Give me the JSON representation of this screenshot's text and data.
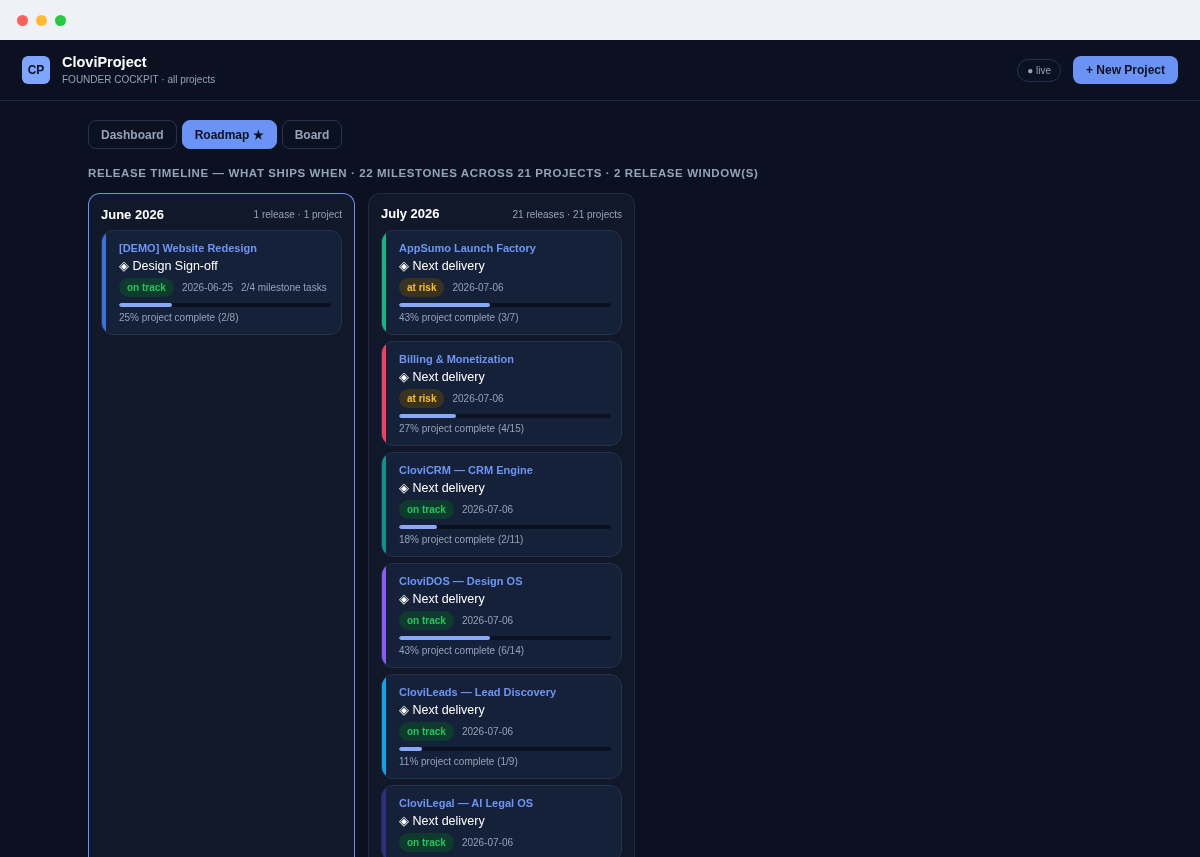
{
  "app": {
    "logo": "CP",
    "title": "CloviProject",
    "subtitle": "FOUNDER COCKPIT · all projects",
    "live_badge": "● live",
    "new_button": "+ New Project"
  },
  "tabs": [
    {
      "label": "Dashboard",
      "selected": false
    },
    {
      "label": "Roadmap ★",
      "selected": true
    },
    {
      "label": "Board",
      "selected": false
    }
  ],
  "heading": "RELEASE TIMELINE — WHAT SHIPS WHEN · 22 MILESTONES ACROSS 21 PROJECTS · 2 RELEASE WINDOW(S)",
  "columns": [
    {
      "title": "June 2026",
      "summary": "1 release · 1 project",
      "selected": true,
      "cards": [
        {
          "project": "[DEMO] Website Redesign",
          "milestone": "◈ Design Sign-off",
          "status": "on track",
          "kind": "on_track",
          "date": "2026-06-25",
          "tasks": "2/4 milestone tasks",
          "level": 0.25,
          "progress": "25% project complete (2/8)",
          "color": "#3b6fd9"
        }
      ]
    },
    {
      "title": "July 2026",
      "summary": "21 releases · 21 projects",
      "selected": false,
      "cards": [
        {
          "project": "AppSumo Launch Factory",
          "milestone": "◈ Next delivery",
          "status": "at risk",
          "kind": "at_risk",
          "date": "2026-07-06",
          "level": 0.43,
          "progress": "43% project complete (3/7)",
          "color": "#10b981"
        },
        {
          "project": "Billing & Monetization",
          "milestone": "◈ Next delivery",
          "status": "at risk",
          "kind": "at_risk",
          "date": "2026-07-06",
          "level": 0.27,
          "progress": "27% project complete (4/15)",
          "color": "#f43f5e"
        },
        {
          "project": "CloviCRM — CRM Engine",
          "milestone": "◈ Next delivery",
          "status": "on track",
          "kind": "on_track",
          "date": "2026-07-06",
          "level": 0.18,
          "progress": "18% project complete (2/11)",
          "color": "#0d9488"
        },
        {
          "project": "CloviDOS — Design OS",
          "milestone": "◈ Next delivery",
          "status": "on track",
          "kind": "on_track",
          "date": "2026-07-06",
          "level": 0.43,
          "progress": "43% project complete (6/14)",
          "color": "#8b5cf6"
        },
        {
          "project": "CloviLeads — Lead Discovery",
          "milestone": "◈ Next delivery",
          "status": "on track",
          "kind": "on_track",
          "date": "2026-07-06",
          "level": 0.11,
          "progress": "11% project complete (1/9)",
          "color": "#0ea5e9"
        },
        {
          "project": "CloviLegal — AI Legal OS",
          "milestone": "◈ Next delivery",
          "status": "on track",
          "kind": "on_track",
          "date": "2026-07-06",
          "color": "#312e81"
        }
      ]
    }
  ]
}
